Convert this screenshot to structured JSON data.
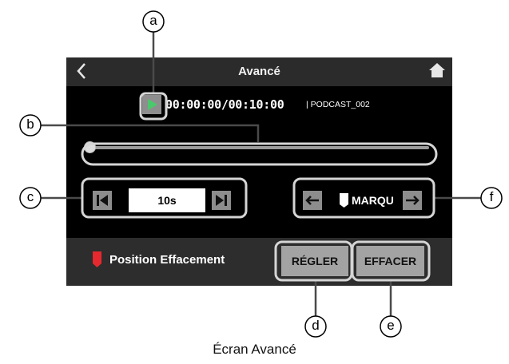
{
  "header": {
    "title": "Avancé"
  },
  "player": {
    "time": "00:00:00/00:10:00",
    "file": "| PODCAST_002",
    "progress_fraction": 0.0
  },
  "skip": {
    "value": "10s"
  },
  "marker": {
    "label": "MARQU"
  },
  "bottom": {
    "erase_label": "Position Effacement",
    "set_label": "RÉGLER",
    "clear_label": "EFFACER"
  },
  "callouts": [
    "a",
    "b",
    "c",
    "d",
    "e",
    "f"
  ],
  "caption": "Écran Avancé",
  "colors": {
    "play_green": "#49c96b",
    "marker_red": "#e5292f",
    "button_gray": "#a3a3a3"
  }
}
